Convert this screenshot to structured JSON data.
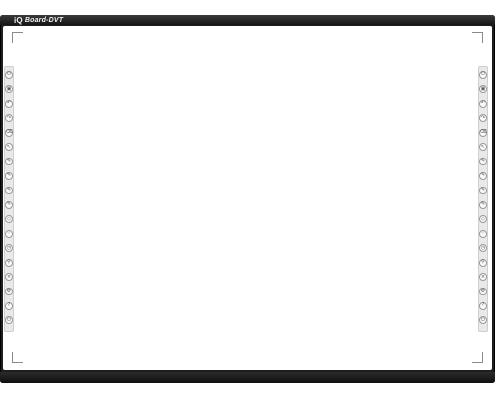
{
  "brand": {
    "logo_mark": "iQ",
    "product_name": "Board-DVT"
  },
  "toolbars": {
    "left": [
      "power-icon",
      "save-icon",
      "undo-icon",
      "redo-icon",
      "eraser-icon",
      "pointer-icon",
      "pen-icon",
      "brush-icon",
      "marker-icon",
      "highlighter-icon",
      "shape-icon",
      "grid-icon",
      "clock-icon",
      "zoom-icon",
      "close-icon",
      "settings-icon",
      "help-icon",
      "exit-icon"
    ],
    "right": [
      "power-icon",
      "save-icon",
      "undo-icon",
      "redo-icon",
      "eraser-icon",
      "pointer-icon",
      "pen-icon",
      "brush-icon",
      "marker-icon",
      "highlighter-icon",
      "shape-icon",
      "grid-icon",
      "clock-icon",
      "zoom-icon",
      "close-icon",
      "settings-icon",
      "help-icon",
      "exit-icon"
    ]
  },
  "glyphs": {
    "power-icon": "⏻",
    "save-icon": "▣",
    "undo-icon": "↶",
    "redo-icon": "↷",
    "eraser-icon": "⌫",
    "pointer-icon": "↖",
    "pen-icon": "✎",
    "brush-icon": "✎",
    "marker-icon": "✎",
    "highlighter-icon": "✎",
    "shape-icon": "◇",
    "grid-icon": "⁘",
    "clock-icon": "◷",
    "zoom-icon": "⚲",
    "close-icon": "×",
    "settings-icon": "⚙",
    "help-icon": "?",
    "exit-icon": "⏻"
  },
  "colors": {
    "frame": "#1e1e1e",
    "board": "#ffffff",
    "toolbar": "#e9e9e9"
  }
}
